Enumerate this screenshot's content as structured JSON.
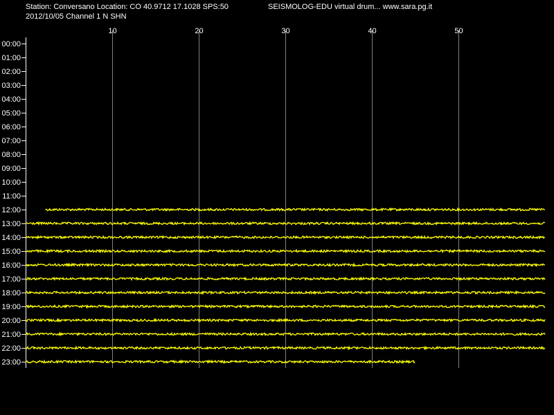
{
  "header": {
    "station_line": "Station: Conversano Location: CO 40.9712 17.1028 SPS:50",
    "date_line": "2012/10/05  Channel 1 N SHN",
    "title": "SEISMOLOG-EDU virtual drum... www.sara.pg.it"
  },
  "colors": {
    "background": "#000000",
    "trace": "#ffff00",
    "grid": "#808080",
    "axis": "#ffffff",
    "text": "#ffffff"
  },
  "chart_data": {
    "type": "line",
    "subtype": "seismogram-drum",
    "x_unit": "minutes",
    "xlim": [
      0,
      60
    ],
    "x_ticks": [
      10,
      20,
      30,
      40,
      50
    ],
    "y_ticks": [
      "00:00",
      "01:00",
      "02:00",
      "03:00",
      "04:00",
      "05:00",
      "06:00",
      "07:00",
      "08:00",
      "09:00",
      "10:00",
      "11:00",
      "12:00",
      "13:00",
      "14:00",
      "15:00",
      "16:00",
      "17:00",
      "18:00",
      "19:00",
      "20:00",
      "21:00",
      "22:00",
      "23:00"
    ],
    "grid": "vertical",
    "traces": [
      {
        "hour": "12:00",
        "start_min": 2.3,
        "end_min": 60
      },
      {
        "hour": "13:00",
        "start_min": 0,
        "end_min": 60
      },
      {
        "hour": "14:00",
        "start_min": 0,
        "end_min": 60
      },
      {
        "hour": "15:00",
        "start_min": 0,
        "end_min": 60
      },
      {
        "hour": "16:00",
        "start_min": 0,
        "end_min": 60
      },
      {
        "hour": "17:00",
        "start_min": 0,
        "end_min": 60
      },
      {
        "hour": "18:00",
        "start_min": 0,
        "end_min": 60
      },
      {
        "hour": "19:00",
        "start_min": 0,
        "end_min": 60
      },
      {
        "hour": "20:00",
        "start_min": 0,
        "end_min": 60
      },
      {
        "hour": "21:00",
        "start_min": 0,
        "end_min": 60
      },
      {
        "hour": "22:00",
        "start_min": 0,
        "end_min": 60
      },
      {
        "hour": "23:00",
        "start_min": 0,
        "end_min": 45
      }
    ]
  }
}
